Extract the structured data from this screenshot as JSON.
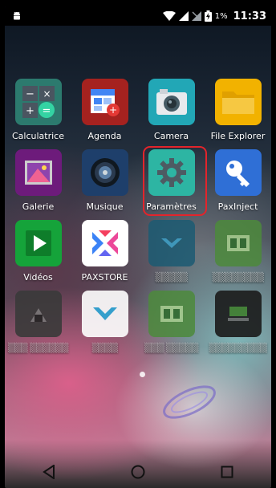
{
  "status_bar": {
    "notification_icon": "android-icon",
    "icons": [
      "wifi-icon",
      "signal-icon",
      "no-sim-icon",
      "battery-charging-icon"
    ],
    "battery_percent": "1%",
    "time": "11:33"
  },
  "apps": [
    {
      "label": "Calculatrice",
      "icon": "calculator-icon"
    },
    {
      "label": "Agenda",
      "icon": "calendar-icon"
    },
    {
      "label": "Camera",
      "icon": "camera-icon"
    },
    {
      "label": "File Explorer",
      "icon": "folder-icon"
    },
    {
      "label": "Galerie",
      "icon": "gallery-icon"
    },
    {
      "label": "Musique",
      "icon": "music-icon"
    },
    {
      "label": "Paramètres",
      "icon": "gear-icon",
      "highlighted": true
    },
    {
      "label": "PaxInject",
      "icon": "key-icon"
    },
    {
      "label": "Vidéos",
      "icon": "video-play-icon"
    },
    {
      "label": "PAXSTORE",
      "icon": "paxstore-icon"
    }
  ],
  "navigation": [
    "back-icon",
    "home-icon",
    "recents-icon"
  ],
  "colors": {
    "highlight": "#e3242b",
    "calculator": "#2c7a6e",
    "agenda": "#a5221f",
    "camera": "#22a7b6",
    "files": "#f2b200",
    "gallery": "#6d1b7b",
    "music": "#1e3f6b",
    "settings": "#2db5a3",
    "paxinject": "#2f6fd6",
    "videos": "#15a33a",
    "paxstore": "#ffffff"
  }
}
